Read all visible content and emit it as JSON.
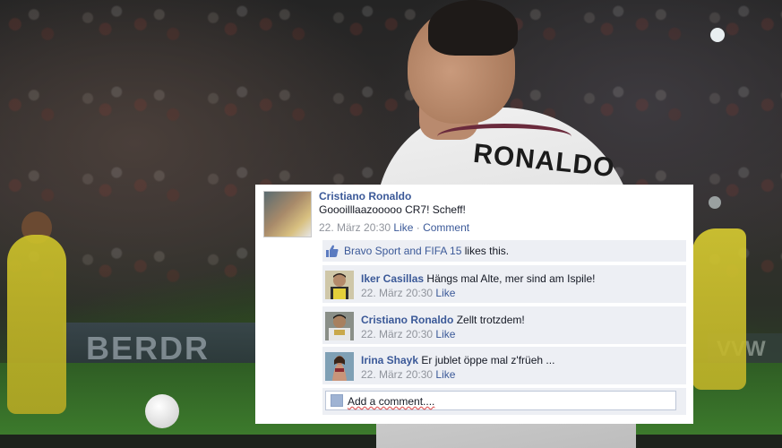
{
  "background": {
    "jersey_name": "RONALDO",
    "adboard_left": "BERDR",
    "adboard_right": "VVW"
  },
  "post": {
    "author": "Cristiano Ronaldo",
    "text": "Goooilllaazooooo CR7! Scheff!",
    "date": "22. März 20:30",
    "like_label": "Like",
    "separator": "·",
    "comment_label": "Comment"
  },
  "likes": {
    "names": "Bravo Sport and FIFA 15",
    "suffix": "likes this."
  },
  "comments": [
    {
      "author": "Iker Casillas",
      "text": "Hängs mal Alte, mer sind am Ispile!",
      "date": "22. März 20:30",
      "like_label": "Like"
    },
    {
      "author": "Cristiano Ronaldo",
      "text": "Zellt trotzdem!",
      "date": "22. März 20:30",
      "like_label": "Like"
    },
    {
      "author": "Irina Shayk",
      "text": "Er jublet öppe mal z'früeh ...",
      "date": "22. März 20:30",
      "like_label": "Like"
    }
  ],
  "add_comment": {
    "label": "Add a comment...."
  },
  "colors": {
    "link": "#3b5998",
    "muted": "#90949c",
    "panel": "#edeff4"
  }
}
